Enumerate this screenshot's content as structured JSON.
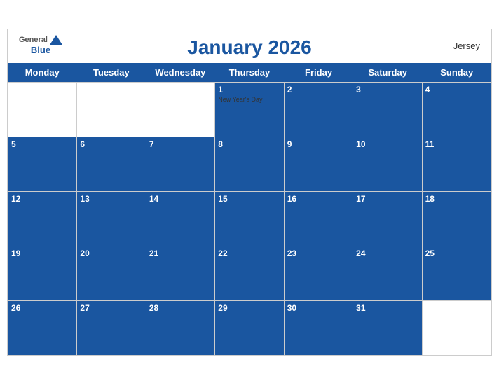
{
  "header": {
    "title": "January 2026",
    "country": "Jersey",
    "logo_general": "General",
    "logo_blue": "Blue"
  },
  "days": [
    "Monday",
    "Tuesday",
    "Wednesday",
    "Thursday",
    "Friday",
    "Saturday",
    "Sunday"
  ],
  "weeks": [
    [
      {
        "num": "",
        "holiday": "",
        "empty": true
      },
      {
        "num": "",
        "holiday": "",
        "empty": true
      },
      {
        "num": "",
        "holiday": "",
        "empty": true
      },
      {
        "num": "1",
        "holiday": "New Year's Day",
        "empty": false
      },
      {
        "num": "2",
        "holiday": "",
        "empty": false
      },
      {
        "num": "3",
        "holiday": "",
        "empty": false
      },
      {
        "num": "4",
        "holiday": "",
        "empty": false
      }
    ],
    [
      {
        "num": "5",
        "holiday": "",
        "empty": false
      },
      {
        "num": "6",
        "holiday": "",
        "empty": false
      },
      {
        "num": "7",
        "holiday": "",
        "empty": false
      },
      {
        "num": "8",
        "holiday": "",
        "empty": false
      },
      {
        "num": "9",
        "holiday": "",
        "empty": false
      },
      {
        "num": "10",
        "holiday": "",
        "empty": false
      },
      {
        "num": "11",
        "holiday": "",
        "empty": false
      }
    ],
    [
      {
        "num": "12",
        "holiday": "",
        "empty": false
      },
      {
        "num": "13",
        "holiday": "",
        "empty": false
      },
      {
        "num": "14",
        "holiday": "",
        "empty": false
      },
      {
        "num": "15",
        "holiday": "",
        "empty": false
      },
      {
        "num": "16",
        "holiday": "",
        "empty": false
      },
      {
        "num": "17",
        "holiday": "",
        "empty": false
      },
      {
        "num": "18",
        "holiday": "",
        "empty": false
      }
    ],
    [
      {
        "num": "19",
        "holiday": "",
        "empty": false
      },
      {
        "num": "20",
        "holiday": "",
        "empty": false
      },
      {
        "num": "21",
        "holiday": "",
        "empty": false
      },
      {
        "num": "22",
        "holiday": "",
        "empty": false
      },
      {
        "num": "23",
        "holiday": "",
        "empty": false
      },
      {
        "num": "24",
        "holiday": "",
        "empty": false
      },
      {
        "num": "25",
        "holiday": "",
        "empty": false
      }
    ],
    [
      {
        "num": "26",
        "holiday": "",
        "empty": false
      },
      {
        "num": "27",
        "holiday": "",
        "empty": false
      },
      {
        "num": "28",
        "holiday": "",
        "empty": false
      },
      {
        "num": "29",
        "holiday": "",
        "empty": false
      },
      {
        "num": "30",
        "holiday": "",
        "empty": false
      },
      {
        "num": "31",
        "holiday": "",
        "empty": false
      },
      {
        "num": "",
        "holiday": "",
        "empty": true
      }
    ]
  ],
  "colors": {
    "blue": "#1a56a0",
    "white": "#ffffff"
  }
}
